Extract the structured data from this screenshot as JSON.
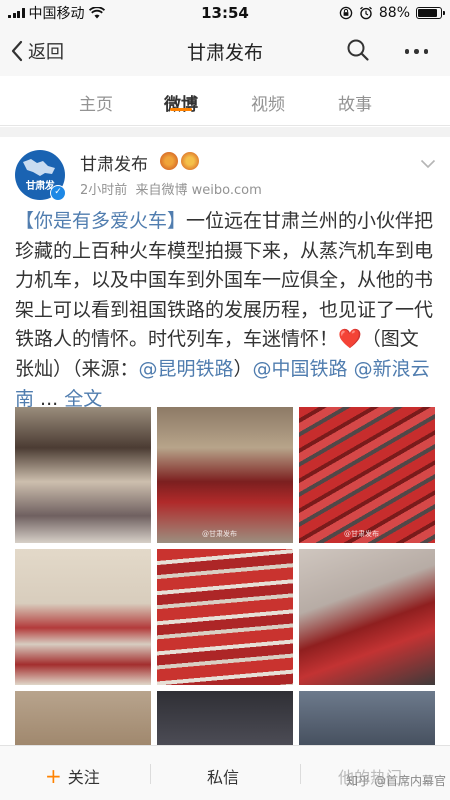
{
  "status_bar": {
    "carrier": "中国移动",
    "time": "13:54",
    "battery": "88%",
    "battery_level": 0.88
  },
  "nav": {
    "back_label": "返回",
    "title": "甘肃发布"
  },
  "tabs": [
    {
      "label": "主页"
    },
    {
      "label": "微博"
    },
    {
      "label": "视频"
    },
    {
      "label": "故事"
    }
  ],
  "active_tab_index": 1,
  "post": {
    "avatar_text": "甘肃发",
    "author": "甘肃发布",
    "time": "2小时前",
    "source": "来自微博 weibo.com",
    "body": {
      "topic": "【你是有多爱火车】",
      "text1": "一位远在甘肃兰州的小伙伴把珍藏的上百种火车模型拍摄下来，从蒸汽机车到电力机车，以及中国车到外国车一应俱全，从他的书架上可以看到祖国铁路的发展历程，也见证了一代铁路人的情怀。时代列车，车迷情怀！",
      "heart": "❤️",
      "text2": "（图文 张灿）（来源：",
      "mention1": "@昆明铁路",
      "text3": "）",
      "mention2": "@中国铁路",
      "mention3": "@新浪云南",
      "ellipsis": " ... ",
      "full_text": "全文"
    },
    "photo_watermark": "@甘肃发布"
  },
  "bottom_bar": {
    "follow_icon": "+",
    "follow_label": "关注",
    "message_label": "私信",
    "hot_label": "他的热门"
  },
  "watermark": "知乎 @首席内幕官",
  "colors": {
    "accent": "#ff8200",
    "link": "#507daf",
    "muted": "#939393",
    "verified": "#1e88e5"
  },
  "icons": [
    "signal-icon",
    "wifi-icon",
    "lock-rotation-icon",
    "alarm-icon",
    "battery-icon",
    "back-chevron-icon",
    "search-icon",
    "more-icon",
    "verified-icon",
    "badge-icon",
    "chevron-down-icon"
  ]
}
